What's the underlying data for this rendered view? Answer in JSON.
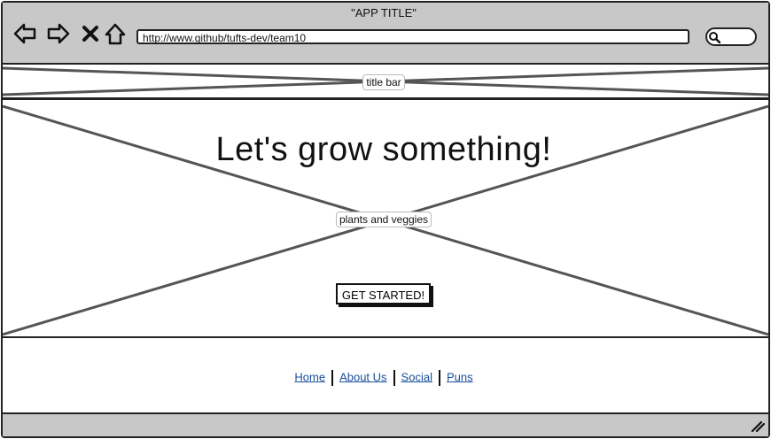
{
  "browser": {
    "app_title": "\"APP TITLE\"",
    "url": "http://www.github/tufts-dev/team10",
    "nav": [
      "back-icon",
      "forward-icon",
      "close-icon",
      "home-icon"
    ],
    "search_icon": "search-icon"
  },
  "title_bar": {
    "label": "title bar"
  },
  "hero": {
    "headline": "Let's grow something!",
    "image_label": "plants and veggies",
    "cta_label": "GET STARTED!"
  },
  "footer": {
    "links": [
      "Home",
      "About Us",
      "Social",
      "Puns"
    ]
  },
  "colors": {
    "chrome": "#c8c8c8",
    "link": "#1a4f9c",
    "placeholder_x": "#555555"
  }
}
